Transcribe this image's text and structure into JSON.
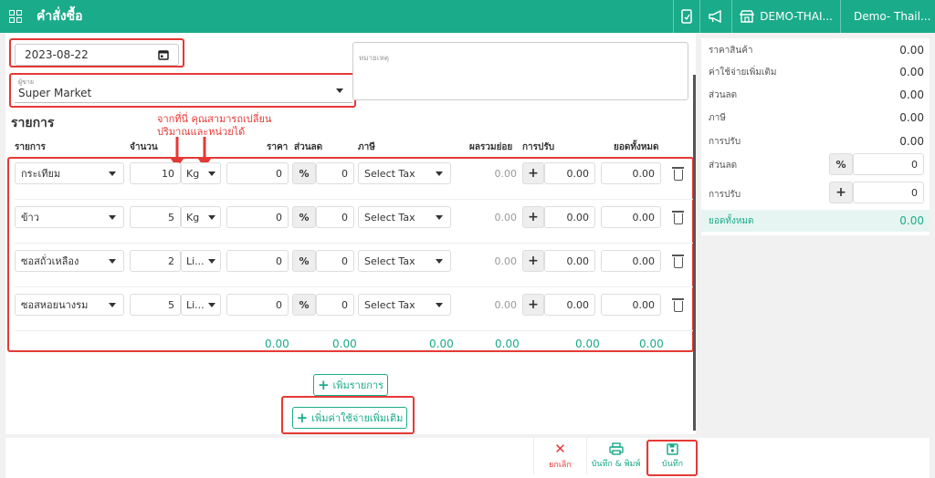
{
  "topbar": {
    "title": "คำสั่งซื้อ",
    "shop": "DEMO-THAI...",
    "user": "Demo- Thail...",
    "bg": "#1aab8a"
  },
  "form": {
    "date": "2023-08-22",
    "note_placeholder": "หมายเหตุ",
    "vendor_label": "ผู้ขาย",
    "vendor": "Super Market"
  },
  "items": {
    "heading": "รายการ",
    "annotation_line1": "จากที่นี่ คุณสามารถเปลี่ยน",
    "annotation_line2": "ปริมาณและหน่วยได้",
    "columns": {
      "item": "รายการ",
      "qty": "จำนวน",
      "price": "ราคา",
      "discount": "ส่วนลด",
      "tax": "ภาษี",
      "subtotal": "ผลรวมย่อย",
      "adjust": "การปรับ",
      "total": "ยอดทั้งหมด"
    },
    "rows": [
      {
        "name": "กระเทียม",
        "qty": "10",
        "unit": "Kg",
        "price": "0",
        "pct": "%",
        "discount": "0",
        "tax": "Select Tax",
        "subtotal": "0.00",
        "plus": "+",
        "adjust": "0.00",
        "total": "0.00"
      },
      {
        "name": "ข้าว",
        "qty": "5",
        "unit": "Kg",
        "price": "0",
        "pct": "%",
        "discount": "0",
        "tax": "Select Tax",
        "subtotal": "0.00",
        "plus": "+",
        "adjust": "0.00",
        "total": "0.00"
      },
      {
        "name": "ซอสถั่วเหลือง",
        "qty": "2",
        "unit": "Li...",
        "price": "0",
        "pct": "%",
        "discount": "0",
        "tax": "Select Tax",
        "subtotal": "0.00",
        "plus": "+",
        "adjust": "0.00",
        "total": "0.00"
      },
      {
        "name": "ซอสหอยนางรม",
        "qty": "5",
        "unit": "Li...",
        "price": "0",
        "pct": "%",
        "discount": "0",
        "tax": "Select Tax",
        "subtotal": "0.00",
        "plus": "+",
        "adjust": "0.00",
        "total": "0.00"
      }
    ],
    "totals": {
      "price": "0.00",
      "discount": "0.00",
      "tax": "0.00",
      "subtotal": "0.00",
      "adjust": "0.00",
      "total": "0.00"
    },
    "add_item": "เพิ่มรายการ",
    "add_expense": "เพิ่มค่าใช้จ่ายเพิ่มเติม"
  },
  "summary": {
    "product_price_label": "ราคาสินค้า",
    "product_price": "0.00",
    "extra_label": "ค่าใช้จ่ายเพิ่มเติม",
    "extra": "0.00",
    "discount_label": "ส่วนลด",
    "discount": "0.00",
    "tax_label": "ภาษี",
    "tax": "0.00",
    "adjust_label": "การปรับ",
    "adjust": "0.00",
    "discount_input_label": "ส่วนลด",
    "discount_pct": "%",
    "discount_input": "0",
    "adjust_input_label": "การปรับ",
    "adjust_plus": "+",
    "adjust_input": "0",
    "grand_total_label": "ยอดทั้งหมด",
    "grand_total": "0.00"
  },
  "actions": {
    "cancel": "ยกเลิก",
    "save_print": "บันทึก & พิมพ์",
    "save": "บันทึก"
  },
  "colors": {
    "accent": "#1aab8a",
    "highlight": "#e53935",
    "cancel": "#e53935"
  }
}
